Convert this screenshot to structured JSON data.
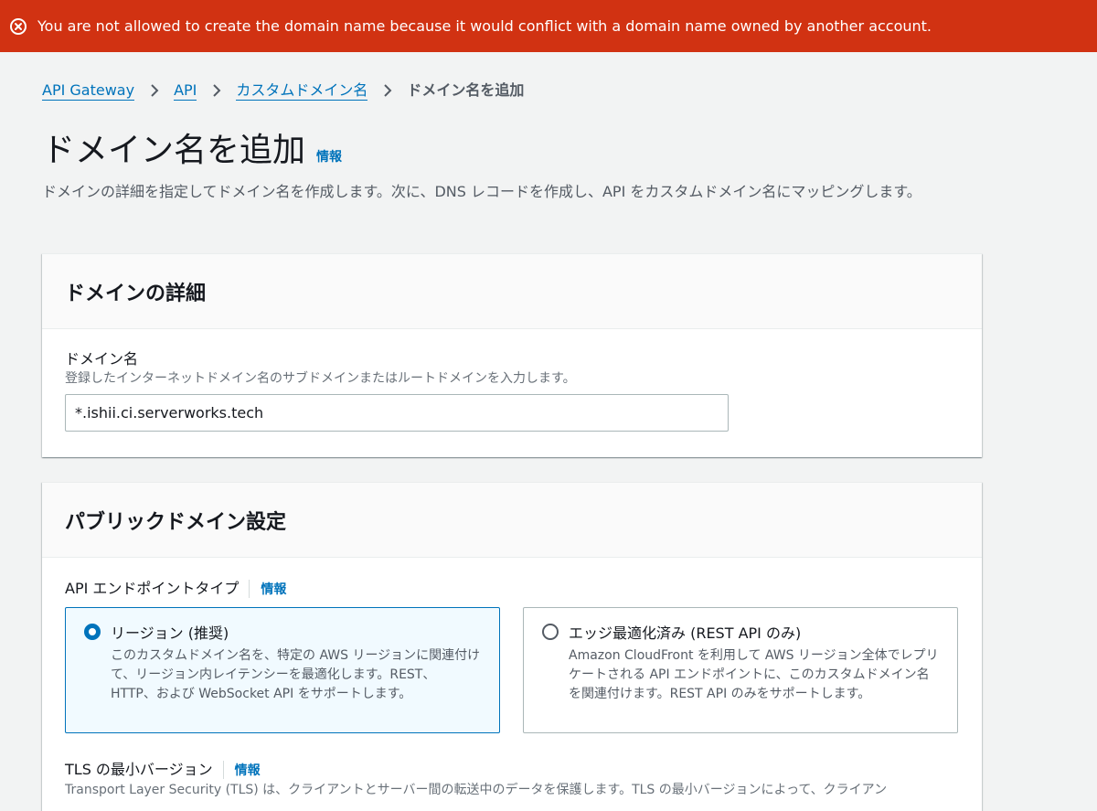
{
  "error_banner": {
    "icon": "error-circle-x-icon",
    "message": "You are not allowed to create the domain name because it would conflict with a domain name owned by another account."
  },
  "breadcrumb": {
    "items": [
      {
        "label": "API Gateway"
      },
      {
        "label": "API"
      },
      {
        "label": "カスタムドメイン名"
      }
    ],
    "current": "ドメイン名を追加",
    "separator_icon": "chevron-right-icon"
  },
  "page": {
    "title": "ドメイン名を追加",
    "info_label": "情報",
    "description": "ドメインの詳細を指定してドメイン名を作成します。次に、DNS レコードを作成し、API をカスタムドメイン名にマッピングします。"
  },
  "domain_details": {
    "title": "ドメインの詳細",
    "domain_name": {
      "label": "ドメイン名",
      "description": "登録したインターネットドメイン名のサブドメインまたはルートドメインを入力します。",
      "value": "*.ishii.ci.serverworks.tech"
    }
  },
  "public_domain": {
    "title": "パブリックドメイン設定",
    "endpoint_type": {
      "label": "API エンドポイントタイプ",
      "info_label": "情報",
      "options": [
        {
          "title": "リージョン (推奨)",
          "description": "このカスタムドメイン名を、特定の AWS リージョンに関連付けて、リージョン内レイテンシーを最適化します。REST、HTTP、および WebSocket API をサポートします。",
          "selected": true
        },
        {
          "title": "エッジ最適化済み (REST API のみ)",
          "description": "Amazon CloudFront を利用して AWS リージョン全体でレプリケートされる API エンドポイントに、このカスタムドメイン名を関連付けます。REST API のみをサポートします。",
          "selected": false
        }
      ]
    },
    "tls": {
      "label": "TLS の最小バージョン",
      "info_label": "情報",
      "description": "Transport Layer Security (TLS) は、クライアントとサーバー間の転送中のデータを保護します。TLS の最小バージョンによって、クライアン"
    }
  },
  "colors": {
    "error_banner": "#d13212",
    "link": "#0073bb",
    "selected_tile_bg": "#f1faff",
    "page_bg": "#f2f3f3"
  }
}
